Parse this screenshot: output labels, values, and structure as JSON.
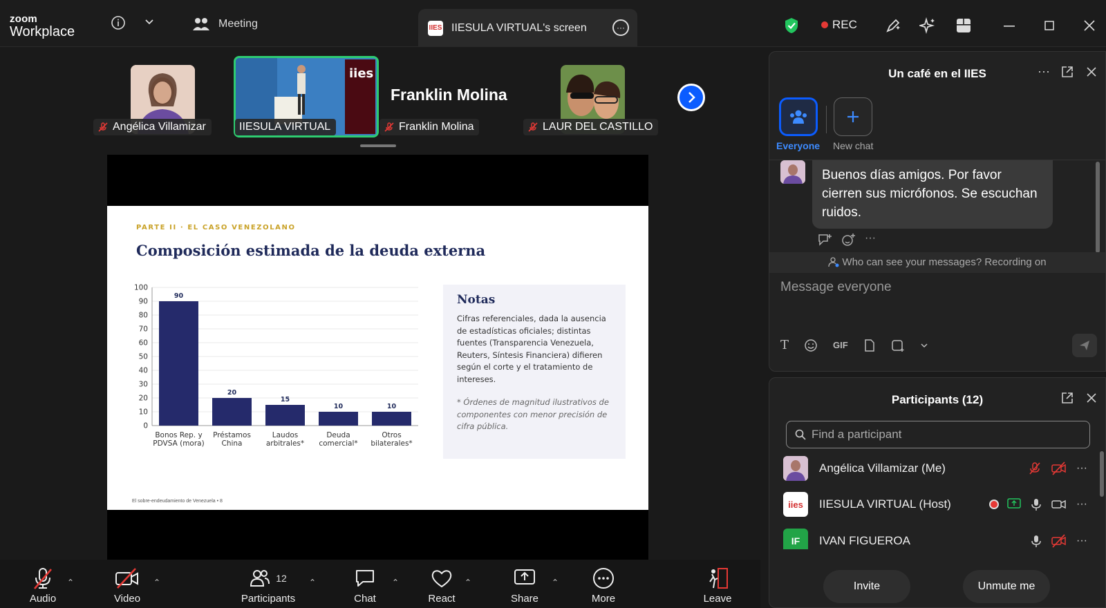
{
  "app": {
    "logo_line1": "zoom",
    "logo_line2": "Workplace"
  },
  "tabs": {
    "meeting_label": "Meeting",
    "screen_label": "IIESULA VIRTUAL's screen",
    "screen_icon": "IIES"
  },
  "header": {
    "rec_label": "REC"
  },
  "gallery": {
    "participants": [
      {
        "name": "Angélica Villamizar"
      },
      {
        "name": "IIESULA VIRTUAL"
      },
      {
        "name": "Franklin Molina",
        "big_name": "Franklin Molina"
      },
      {
        "name": "LAUR DEL CASTILLO"
      }
    ]
  },
  "slide": {
    "kicker": "PARTE II · EL CASO VENEZOLANO",
    "title": "Composición estimada de la deuda externa",
    "notes_title": "Notas",
    "notes_body": "Cifras referenciales, dada la ausencia de estadísticas oficiales; distintas fuentes (Transparencia Venezuela, Reuters, Síntesis Financiera) difieren según el corte y el tratamiento de intereses.",
    "notes_foot": "* Órdenes de magnitud ilustrativos de componentes con menor precisión de cifra pública.",
    "footer": "El sobre-endeudamiento de Venezuela  •  8"
  },
  "chart_data": {
    "type": "bar",
    "categories": [
      [
        "Bonos Rep. y",
        "PDVSA (mora)"
      ],
      [
        "Préstamos",
        "China"
      ],
      [
        "Laudos",
        "arbitrales*"
      ],
      [
        "Deuda",
        "comercial*"
      ],
      [
        "Otros",
        "bilaterales*"
      ]
    ],
    "values": [
      90,
      20,
      15,
      10,
      10
    ],
    "ylim": [
      0,
      100
    ],
    "yticks": [
      0,
      10,
      20,
      30,
      40,
      50,
      60,
      70,
      80,
      90,
      100
    ],
    "bar_color": "#252a6b",
    "grid": true
  },
  "toolbar": {
    "audio": "Audio",
    "video": "Video",
    "participants": "Participants",
    "participants_count": "12",
    "chat": "Chat",
    "react": "React",
    "share": "Share",
    "more": "More",
    "leave": "Leave"
  },
  "chat": {
    "title": "Un café en el IIES",
    "channel_everyone": "Everyone",
    "channel_new": "New chat",
    "message": "Buenos días amigos. Por favor cierren sus micrófonos. Se escuchan ruidos.",
    "visibility": "Who can see your messages? Recording on",
    "compose_placeholder": "Message everyone",
    "gif_label": "GIF"
  },
  "participants_panel": {
    "title": "Participants (12)",
    "search_placeholder": "Find a participant",
    "rows": [
      {
        "name": "Angélica Villamizar (Me)",
        "initials": ""
      },
      {
        "name": "IIESULA VIRTUAL (Host)",
        "initials": "iies"
      },
      {
        "name": "IVAN FIGUEROA",
        "initials": "IF"
      }
    ],
    "invite": "Invite",
    "unmute": "Unmute me"
  },
  "colors": {
    "accent": "#0b5cff",
    "active_speaker": "#2ecc71",
    "bar": "#252a6b",
    "slide_title": "#1f2a5a",
    "kicker": "#c9a227"
  }
}
